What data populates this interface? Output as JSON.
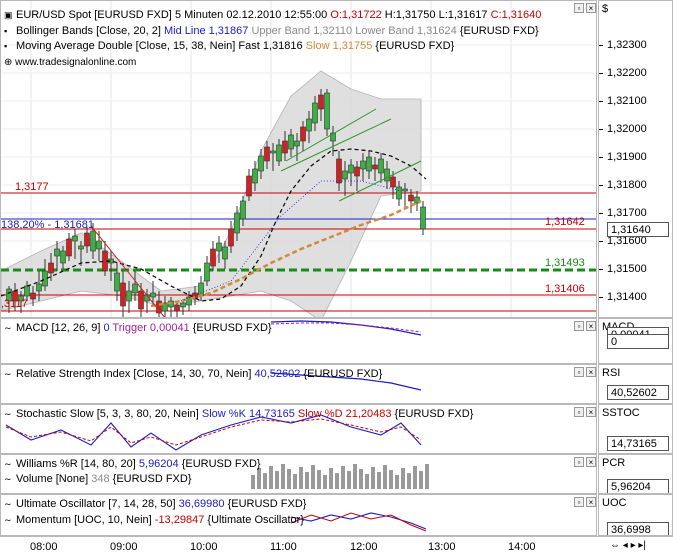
{
  "main": {
    "header": {
      "symbol": "EUR/USD Spot [EURUSD FXD]",
      "interval": "5 Minuten",
      "datetime": "02.12.2010 12:55:00",
      "open": "O:1,31722",
      "high": "H:1,31750",
      "low": "L:1,31617",
      "close": "C:1,31640"
    },
    "bollinger": {
      "name": "Bollinger Bands [Close, 20, 2]",
      "mid": "Mid Line 1,31867",
      "upper": "Upper Band 1,32110",
      "lower": "Lower Band 1,31624",
      "src": "{EURUSD FXD}"
    },
    "ma": {
      "name": "Moving Average Double [Close, 15, 38, Nein]",
      "fast": "Fast 1,31816",
      "slow": "Slow 1,31755",
      "src": "{EURUSD FXD}"
    },
    "website": "www.tradesignalonline.com",
    "hlines": {
      "l1": "1,3177",
      "l2": "138,20% - 1,31681",
      "l3": "1,31642",
      "l4": "1,31493",
      "l5": "1,31406",
      "l6": ",3117"
    }
  },
  "axis": {
    "currency": "$",
    "ticks": [
      "1,32300",
      "1,32200",
      "1,32100",
      "1,32000",
      "1,31900",
      "1,31800",
      "1,31700",
      "1,31600",
      "1,31500",
      "1,31400"
    ],
    "price_tag": "1,31640"
  },
  "macd": {
    "legend": "MACD [12, 26, 9]",
    "val": "0",
    "trigger": "Trigger 0,00041",
    "src": "{EURUSD FXD}",
    "label": "MACD",
    "tag1": "0,00041",
    "tag2": "0"
  },
  "rsi": {
    "legend": "Relative Strength Index [Close, 14, 30, 70, Nein]",
    "val": "40,52602",
    "src": "{EURUSD FXD}",
    "label": "RSI",
    "tag": "40,52602"
  },
  "stoch": {
    "legend": "Stochastic Slow [5, 3, 3, 80, 20, Nein]",
    "k": "Slow %K 14,73165",
    "d": "Slow %D 21,20483",
    "src": "{EURUSD FXD}",
    "label": "SSTOC",
    "tag": "14,73165"
  },
  "williams": {
    "legend": "Williams %R [14, 80, 20]",
    "val": "5,96204",
    "src": "{EURUSD FXD}",
    "vol_legend": "Volume [None]",
    "vol_val": "348",
    "vol_src": "{EURUSD FXD}",
    "label": "PCR",
    "tag": "5,96204"
  },
  "uo": {
    "legend": "Ultimate Oscillator [7, 14, 28, 50]",
    "val": "36,69980",
    "src": "{EURUSD FXD}",
    "mom_legend": "Momentum [UOC, 10, Nein]",
    "mom_val": "-13,29847",
    "mom_src": "{Ultimate Oscillator}",
    "label": "UOC",
    "tag": "36,6998"
  },
  "time": [
    "08:00",
    "09:00",
    "10:00",
    "11:00",
    "12:00",
    "13:00",
    "14:00"
  ],
  "colors": {
    "up": "#3cb043",
    "down": "#d42020",
    "band": "#c8c8c8",
    "blue": "#1c1cc8",
    "red": "#c80000",
    "green": "#1a8a1a"
  }
}
